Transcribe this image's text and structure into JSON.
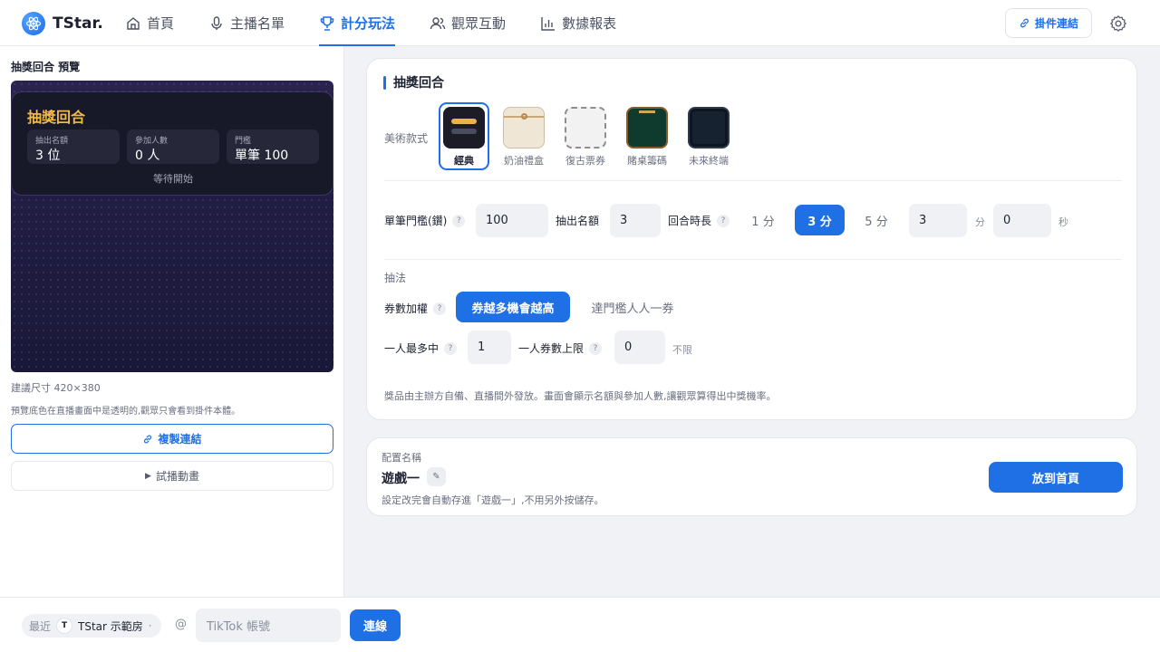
{
  "app": {
    "brand": "TStar."
  },
  "nav": {
    "items": [
      {
        "label": "首頁",
        "icon": "home-icon"
      },
      {
        "label": "主播名單",
        "icon": "microphone-icon"
      },
      {
        "label": "計分玩法",
        "icon": "trophy-icon",
        "active": true
      },
      {
        "label": "觀眾互動",
        "icon": "users-icon"
      },
      {
        "label": "數據報表",
        "icon": "bar-chart-icon"
      }
    ],
    "plugin_link": "掛件連結",
    "settings_icon": "gear-icon"
  },
  "preview": {
    "title": "抽獎回合 預覽",
    "card_title": "抽獎回合",
    "stats": [
      {
        "label": "抽出名額",
        "value": "3 位"
      },
      {
        "label": "參加人數",
        "value": "0 人"
      },
      {
        "label": "門檻",
        "value": "單筆 100"
      }
    ],
    "status": "等待開始",
    "size_hint": "建議尺寸 420×380",
    "note": "預覽底色在直播畫面中是透明的,觀眾只會看到掛件本體。",
    "copy_link": "複製連結",
    "play_anim": "試播動畫"
  },
  "settings": {
    "title": "抽獎回合",
    "style_label": "美術款式",
    "styles": [
      {
        "label": "經典",
        "selected": true
      },
      {
        "label": "奶油禮盒"
      },
      {
        "label": "復古票券"
      },
      {
        "label": "賭桌籌碼"
      },
      {
        "label": "未來終端"
      }
    ],
    "threshold_label": "單筆門檻(鑽)",
    "threshold_value": "100",
    "winners_label": "抽出名額",
    "winners_value": "3",
    "duration_label": "回合時長",
    "duration_options": [
      "1 分",
      "3 分",
      "5 分"
    ],
    "duration_selected": "3 分",
    "duration_min": "3",
    "min_unit": "分",
    "duration_sec": "0",
    "sec_unit": "秒",
    "method_label": "抽法",
    "weight_label": "券數加權",
    "weight_options": [
      "券越多機會越高",
      "達門檻人人一券"
    ],
    "weight_selected": "券越多機會越高",
    "max_win_label": "一人最多中",
    "max_win_value": "1",
    "ticket_cap_label": "一人券數上限",
    "ticket_cap_value": "0",
    "ticket_cap_hint": "不限",
    "footnote": "獎品由主辦方自備、直播間外發放。畫面會顯示名額與參加人數,讓觀眾算得出中獎機率。"
  },
  "config": {
    "label": "配置名稱",
    "name": "遊戲一",
    "edit_icon": "✎",
    "desc": "設定改完會自動存進「遊戲一」,不用另外按儲存。",
    "home_button": "放到首頁"
  },
  "bottom": {
    "recent_label": "最近",
    "avatar_letter": "T",
    "room_name": "TStar 示範房",
    "dropdown_icon": "·",
    "at": "@",
    "tiktok_placeholder": "TikTok 帳號",
    "connect": "連線"
  },
  "colors": {
    "accent": "#1f6fe5",
    "gold": "#f2b84b",
    "preview_bg": "#211d44"
  }
}
